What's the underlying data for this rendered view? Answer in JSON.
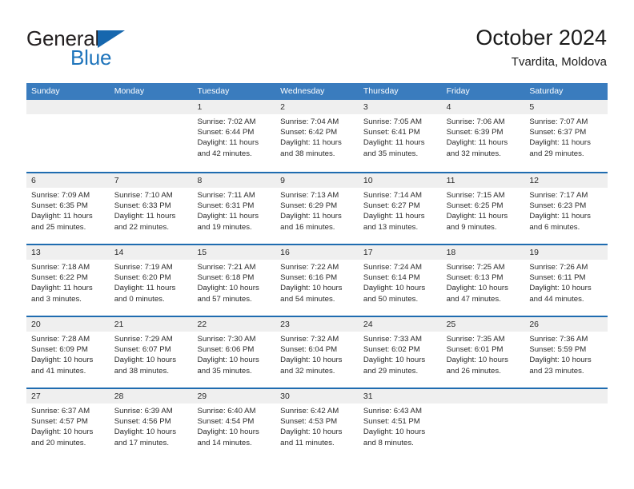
{
  "brand": {
    "name_part1": "General",
    "name_part2": "Blue",
    "flag_icon": "triangle-flag-icon"
  },
  "header": {
    "title": "October 2024",
    "subtitle": "Tvardita, Moldova"
  },
  "colors": {
    "header_blue": "#3a7cbe",
    "week_divider_blue": "#1f6cb0",
    "day_band_gray": "#efefef",
    "brand_blue": "#1e74bb",
    "text": "#2b2b2b"
  },
  "calendar": {
    "weekday_headers": [
      "Sunday",
      "Monday",
      "Tuesday",
      "Wednesday",
      "Thursday",
      "Friday",
      "Saturday"
    ],
    "weeks": [
      [
        {
          "day": "",
          "empty": true
        },
        {
          "day": "",
          "empty": true
        },
        {
          "day": "1",
          "sunrise": "Sunrise: 7:02 AM",
          "sunset": "Sunset: 6:44 PM",
          "daylight": "Daylight: 11 hours and 42 minutes."
        },
        {
          "day": "2",
          "sunrise": "Sunrise: 7:04 AM",
          "sunset": "Sunset: 6:42 PM",
          "daylight": "Daylight: 11 hours and 38 minutes."
        },
        {
          "day": "3",
          "sunrise": "Sunrise: 7:05 AM",
          "sunset": "Sunset: 6:41 PM",
          "daylight": "Daylight: 11 hours and 35 minutes."
        },
        {
          "day": "4",
          "sunrise": "Sunrise: 7:06 AM",
          "sunset": "Sunset: 6:39 PM",
          "daylight": "Daylight: 11 hours and 32 minutes."
        },
        {
          "day": "5",
          "sunrise": "Sunrise: 7:07 AM",
          "sunset": "Sunset: 6:37 PM",
          "daylight": "Daylight: 11 hours and 29 minutes."
        }
      ],
      [
        {
          "day": "6",
          "sunrise": "Sunrise: 7:09 AM",
          "sunset": "Sunset: 6:35 PM",
          "daylight": "Daylight: 11 hours and 25 minutes."
        },
        {
          "day": "7",
          "sunrise": "Sunrise: 7:10 AM",
          "sunset": "Sunset: 6:33 PM",
          "daylight": "Daylight: 11 hours and 22 minutes."
        },
        {
          "day": "8",
          "sunrise": "Sunrise: 7:11 AM",
          "sunset": "Sunset: 6:31 PM",
          "daylight": "Daylight: 11 hours and 19 minutes."
        },
        {
          "day": "9",
          "sunrise": "Sunrise: 7:13 AM",
          "sunset": "Sunset: 6:29 PM",
          "daylight": "Daylight: 11 hours and 16 minutes."
        },
        {
          "day": "10",
          "sunrise": "Sunrise: 7:14 AM",
          "sunset": "Sunset: 6:27 PM",
          "daylight": "Daylight: 11 hours and 13 minutes."
        },
        {
          "day": "11",
          "sunrise": "Sunrise: 7:15 AM",
          "sunset": "Sunset: 6:25 PM",
          "daylight": "Daylight: 11 hours and 9 minutes."
        },
        {
          "day": "12",
          "sunrise": "Sunrise: 7:17 AM",
          "sunset": "Sunset: 6:23 PM",
          "daylight": "Daylight: 11 hours and 6 minutes."
        }
      ],
      [
        {
          "day": "13",
          "sunrise": "Sunrise: 7:18 AM",
          "sunset": "Sunset: 6:22 PM",
          "daylight": "Daylight: 11 hours and 3 minutes."
        },
        {
          "day": "14",
          "sunrise": "Sunrise: 7:19 AM",
          "sunset": "Sunset: 6:20 PM",
          "daylight": "Daylight: 11 hours and 0 minutes."
        },
        {
          "day": "15",
          "sunrise": "Sunrise: 7:21 AM",
          "sunset": "Sunset: 6:18 PM",
          "daylight": "Daylight: 10 hours and 57 minutes."
        },
        {
          "day": "16",
          "sunrise": "Sunrise: 7:22 AM",
          "sunset": "Sunset: 6:16 PM",
          "daylight": "Daylight: 10 hours and 54 minutes."
        },
        {
          "day": "17",
          "sunrise": "Sunrise: 7:24 AM",
          "sunset": "Sunset: 6:14 PM",
          "daylight": "Daylight: 10 hours and 50 minutes."
        },
        {
          "day": "18",
          "sunrise": "Sunrise: 7:25 AM",
          "sunset": "Sunset: 6:13 PM",
          "daylight": "Daylight: 10 hours and 47 minutes."
        },
        {
          "day": "19",
          "sunrise": "Sunrise: 7:26 AM",
          "sunset": "Sunset: 6:11 PM",
          "daylight": "Daylight: 10 hours and 44 minutes."
        }
      ],
      [
        {
          "day": "20",
          "sunrise": "Sunrise: 7:28 AM",
          "sunset": "Sunset: 6:09 PM",
          "daylight": "Daylight: 10 hours and 41 minutes."
        },
        {
          "day": "21",
          "sunrise": "Sunrise: 7:29 AM",
          "sunset": "Sunset: 6:07 PM",
          "daylight": "Daylight: 10 hours and 38 minutes."
        },
        {
          "day": "22",
          "sunrise": "Sunrise: 7:30 AM",
          "sunset": "Sunset: 6:06 PM",
          "daylight": "Daylight: 10 hours and 35 minutes."
        },
        {
          "day": "23",
          "sunrise": "Sunrise: 7:32 AM",
          "sunset": "Sunset: 6:04 PM",
          "daylight": "Daylight: 10 hours and 32 minutes."
        },
        {
          "day": "24",
          "sunrise": "Sunrise: 7:33 AM",
          "sunset": "Sunset: 6:02 PM",
          "daylight": "Daylight: 10 hours and 29 minutes."
        },
        {
          "day": "25",
          "sunrise": "Sunrise: 7:35 AM",
          "sunset": "Sunset: 6:01 PM",
          "daylight": "Daylight: 10 hours and 26 minutes."
        },
        {
          "day": "26",
          "sunrise": "Sunrise: 7:36 AM",
          "sunset": "Sunset: 5:59 PM",
          "daylight": "Daylight: 10 hours and 23 minutes."
        }
      ],
      [
        {
          "day": "27",
          "sunrise": "Sunrise: 6:37 AM",
          "sunset": "Sunset: 4:57 PM",
          "daylight": "Daylight: 10 hours and 20 minutes."
        },
        {
          "day": "28",
          "sunrise": "Sunrise: 6:39 AM",
          "sunset": "Sunset: 4:56 PM",
          "daylight": "Daylight: 10 hours and 17 minutes."
        },
        {
          "day": "29",
          "sunrise": "Sunrise: 6:40 AM",
          "sunset": "Sunset: 4:54 PM",
          "daylight": "Daylight: 10 hours and 14 minutes."
        },
        {
          "day": "30",
          "sunrise": "Sunrise: 6:42 AM",
          "sunset": "Sunset: 4:53 PM",
          "daylight": "Daylight: 10 hours and 11 minutes."
        },
        {
          "day": "31",
          "sunrise": "Sunrise: 6:43 AM",
          "sunset": "Sunset: 4:51 PM",
          "daylight": "Daylight: 10 hours and 8 minutes."
        },
        {
          "day": "",
          "empty": true
        },
        {
          "day": "",
          "empty": true
        }
      ]
    ]
  }
}
